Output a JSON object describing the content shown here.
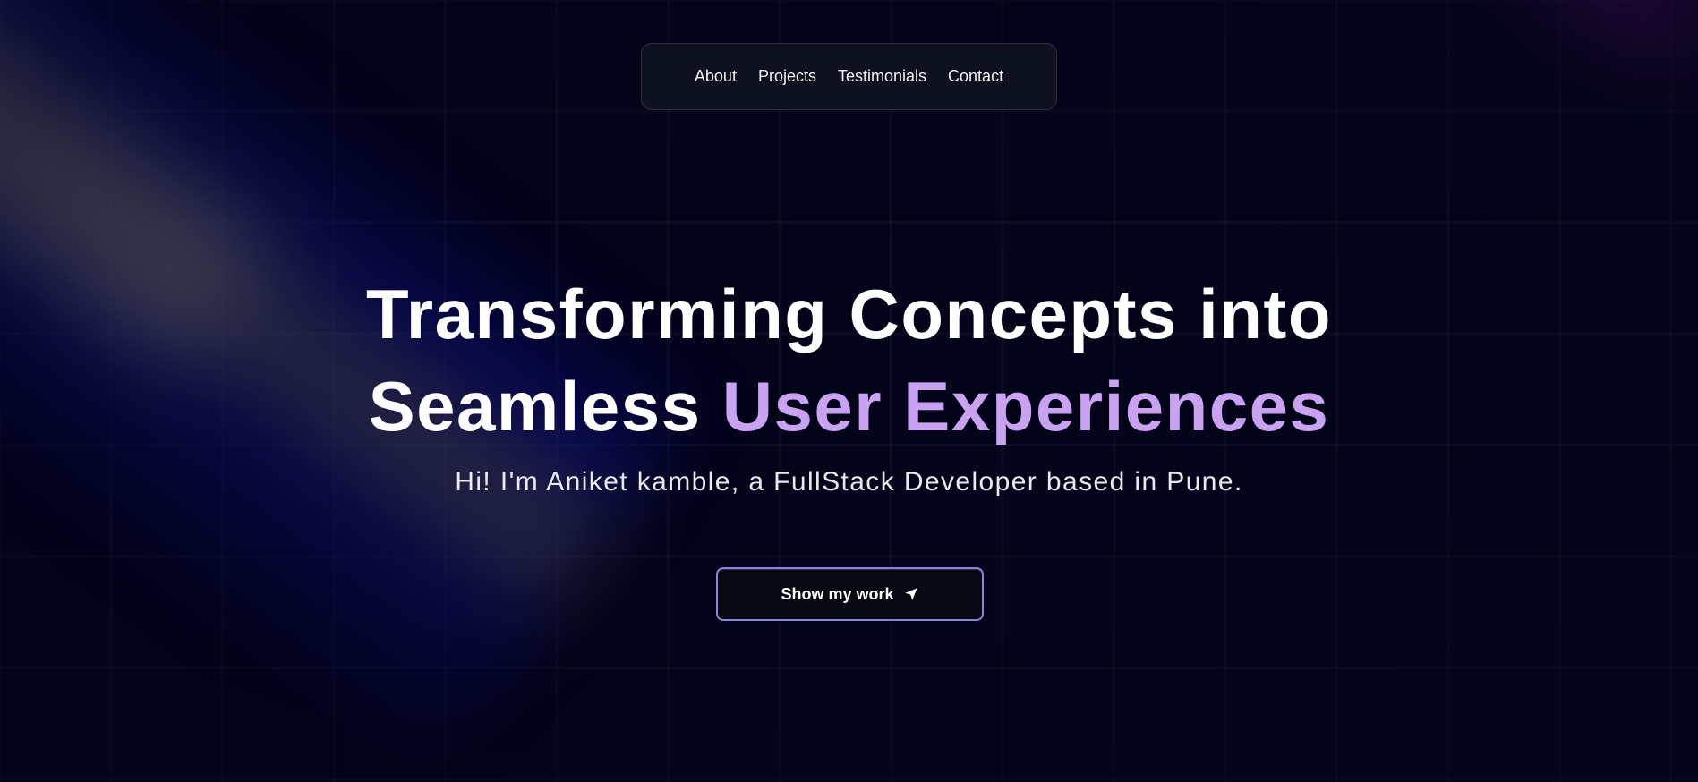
{
  "nav": {
    "items": [
      {
        "label": "About"
      },
      {
        "label": "Projects"
      },
      {
        "label": "Testimonials"
      },
      {
        "label": "Contact"
      }
    ]
  },
  "hero": {
    "title_line1": "Transforming Concepts into",
    "title_line2_plain": "Seamless",
    "title_line2_accent": "User Experiences",
    "subtitle": "Hi! I'm Aniket kamble, a FullStack Developer based in Pune."
  },
  "cta": {
    "label": "Show my work",
    "icon": "location-arrow-icon"
  },
  "colors": {
    "background": "#03031a",
    "accent": "#c9a3f2",
    "button_border": "#8c84d8",
    "nav_background": "#0e1220"
  }
}
